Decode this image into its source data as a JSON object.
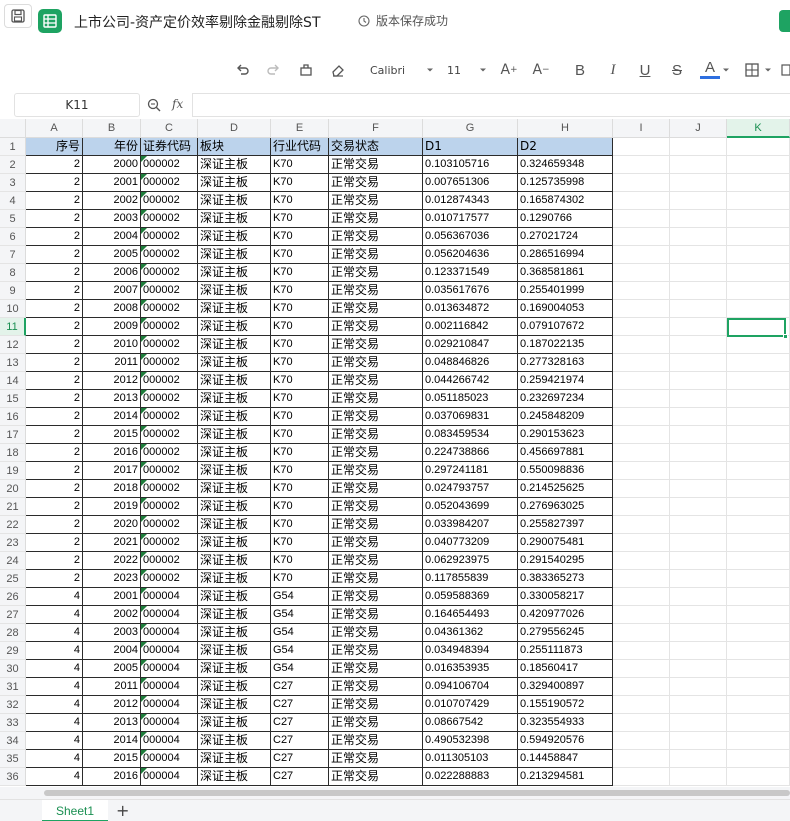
{
  "title_bar": {
    "doc_title": "上市公司-资产定价效率剔除金融剔除ST",
    "save_status": "版本保存成功",
    "save_icon": "floppy-disk-icon",
    "app_icon": "spreadsheet-app-icon"
  },
  "toolbar": {
    "font_name": "Calibri",
    "font_size": "11",
    "icons": [
      "undo-icon",
      "redo-icon",
      "format-painter-icon",
      "clear-format-icon",
      "increase-font-icon",
      "decrease-font-icon",
      "bold-icon",
      "italic-icon",
      "underline-icon",
      "strikethrough-icon",
      "font-color-icon",
      "borders-icon"
    ],
    "bold_label": "B",
    "italic_label": "I",
    "underline_label": "U",
    "strike_label": "S",
    "font_color_label": "A",
    "font_color": "#2e6fe0"
  },
  "formula_bar": {
    "name_box": "K11",
    "fx_label": "fx",
    "formula": ""
  },
  "grid": {
    "columns": [
      "A",
      "B",
      "C",
      "D",
      "E",
      "F",
      "G",
      "H",
      "I",
      "J",
      "K"
    ],
    "selected_column": "K",
    "selected_row": "11",
    "header_row": [
      "序号",
      "年份",
      "证券代码",
      "板块",
      "行业代码",
      "交易状态",
      "D1",
      "D2"
    ],
    "rows": [
      [
        "2",
        "2000",
        "000002",
        "深证主板",
        "K70",
        "正常交易",
        "0.103105716",
        "0.324659348"
      ],
      [
        "2",
        "2001",
        "000002",
        "深证主板",
        "K70",
        "正常交易",
        "0.007651306",
        "0.125735998"
      ],
      [
        "2",
        "2002",
        "000002",
        "深证主板",
        "K70",
        "正常交易",
        "0.012874343",
        "0.165874302"
      ],
      [
        "2",
        "2003",
        "000002",
        "深证主板",
        "K70",
        "正常交易",
        "0.010717577",
        "0.1290766"
      ],
      [
        "2",
        "2004",
        "000002",
        "深证主板",
        "K70",
        "正常交易",
        "0.056367036",
        "0.27021724"
      ],
      [
        "2",
        "2005",
        "000002",
        "深证主板",
        "K70",
        "正常交易",
        "0.056204636",
        "0.286516994"
      ],
      [
        "2",
        "2006",
        "000002",
        "深证主板",
        "K70",
        "正常交易",
        "0.123371549",
        "0.368581861"
      ],
      [
        "2",
        "2007",
        "000002",
        "深证主板",
        "K70",
        "正常交易",
        "0.035617676",
        "0.255401999"
      ],
      [
        "2",
        "2008",
        "000002",
        "深证主板",
        "K70",
        "正常交易",
        "0.013634872",
        "0.169004053"
      ],
      [
        "2",
        "2009",
        "000002",
        "深证主板",
        "K70",
        "正常交易",
        "0.002116842",
        "0.079107672"
      ],
      [
        "2",
        "2010",
        "000002",
        "深证主板",
        "K70",
        "正常交易",
        "0.029210847",
        "0.187022135"
      ],
      [
        "2",
        "2011",
        "000002",
        "深证主板",
        "K70",
        "正常交易",
        "0.048846826",
        "0.277328163"
      ],
      [
        "2",
        "2012",
        "000002",
        "深证主板",
        "K70",
        "正常交易",
        "0.044266742",
        "0.259421974"
      ],
      [
        "2",
        "2013",
        "000002",
        "深证主板",
        "K70",
        "正常交易",
        "0.051185023",
        "0.232697234"
      ],
      [
        "2",
        "2014",
        "000002",
        "深证主板",
        "K70",
        "正常交易",
        "0.037069831",
        "0.245848209"
      ],
      [
        "2",
        "2015",
        "000002",
        "深证主板",
        "K70",
        "正常交易",
        "0.083459534",
        "0.290153623"
      ],
      [
        "2",
        "2016",
        "000002",
        "深证主板",
        "K70",
        "正常交易",
        "0.224738866",
        "0.456697881"
      ],
      [
        "2",
        "2017",
        "000002",
        "深证主板",
        "K70",
        "正常交易",
        "0.297241181",
        "0.550098836"
      ],
      [
        "2",
        "2018",
        "000002",
        "深证主板",
        "K70",
        "正常交易",
        "0.024793757",
        "0.214525625"
      ],
      [
        "2",
        "2019",
        "000002",
        "深证主板",
        "K70",
        "正常交易",
        "0.052043699",
        "0.276963025"
      ],
      [
        "2",
        "2020",
        "000002",
        "深证主板",
        "K70",
        "正常交易",
        "0.033984207",
        "0.255827397"
      ],
      [
        "2",
        "2021",
        "000002",
        "深证主板",
        "K70",
        "正常交易",
        "0.040773209",
        "0.290075481"
      ],
      [
        "2",
        "2022",
        "000002",
        "深证主板",
        "K70",
        "正常交易",
        "0.062923975",
        "0.291540295"
      ],
      [
        "2",
        "2023",
        "000002",
        "深证主板",
        "K70",
        "正常交易",
        "0.117855839",
        "0.383365273"
      ],
      [
        "4",
        "2001",
        "000004",
        "深证主板",
        "G54",
        "正常交易",
        "0.059588369",
        "0.330058217"
      ],
      [
        "4",
        "2002",
        "000004",
        "深证主板",
        "G54",
        "正常交易",
        "0.164654493",
        "0.420977026"
      ],
      [
        "4",
        "2003",
        "000004",
        "深证主板",
        "G54",
        "正常交易",
        "0.04361362",
        "0.279556245"
      ],
      [
        "4",
        "2004",
        "000004",
        "深证主板",
        "G54",
        "正常交易",
        "0.034948394",
        "0.255111873"
      ],
      [
        "4",
        "2005",
        "000004",
        "深证主板",
        "G54",
        "正常交易",
        "0.016353935",
        "0.18560417"
      ],
      [
        "4",
        "2011",
        "000004",
        "深证主板",
        "C27",
        "正常交易",
        "0.094106704",
        "0.329400897"
      ],
      [
        "4",
        "2012",
        "000004",
        "深证主板",
        "C27",
        "正常交易",
        "0.010707429",
        "0.155190572"
      ],
      [
        "4",
        "2013",
        "000004",
        "深证主板",
        "C27",
        "正常交易",
        "0.08667542",
        "0.323554933"
      ],
      [
        "4",
        "2014",
        "000004",
        "深证主板",
        "C27",
        "正常交易",
        "0.490532398",
        "0.594920576"
      ],
      [
        "4",
        "2015",
        "000004",
        "深证主板",
        "C27",
        "正常交易",
        "0.011305103",
        "0.14458847"
      ],
      [
        "4",
        "2016",
        "000004",
        "深证主板",
        "C27",
        "正常交易",
        "0.022288883",
        "0.213294581"
      ]
    ]
  },
  "sheets": {
    "active": "Sheet1",
    "add_label": "+"
  },
  "colors": {
    "accent": "#1ea362",
    "header_fill": "#bcd3ec"
  }
}
